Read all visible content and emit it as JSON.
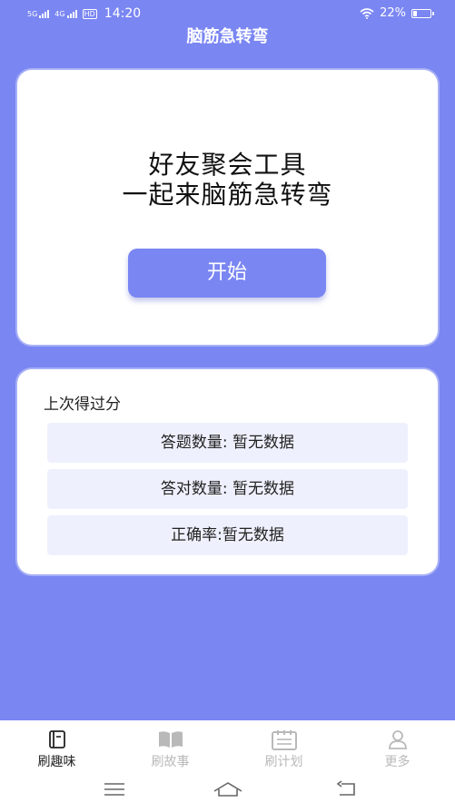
{
  "status_bar": {
    "network1": "5G",
    "network2": "4G",
    "hd": "HD",
    "time": "14:20",
    "battery_text": "22%",
    "battery_level": 0.22
  },
  "header": {
    "title": "脑筋急转弯"
  },
  "hero": {
    "line1": "好友聚会工具",
    "line2": "一起来脑筋急转弯",
    "start_label": "开始"
  },
  "score": {
    "title": "上次得过分",
    "rows": [
      {
        "text": "答题数量: 暂无数据"
      },
      {
        "text": "答对数量: 暂无数据"
      },
      {
        "text": "正确率:暂无数据"
      }
    ]
  },
  "tabs": [
    {
      "label": "刷趣味",
      "active": true
    },
    {
      "label": "刷故事",
      "active": false
    },
    {
      "label": "刷计划",
      "active": false
    },
    {
      "label": "更多",
      "active": false
    }
  ],
  "colors": {
    "accent": "#7a86f2",
    "row_bg": "#eef1fd",
    "tab_inactive": "#b9b9b9"
  }
}
